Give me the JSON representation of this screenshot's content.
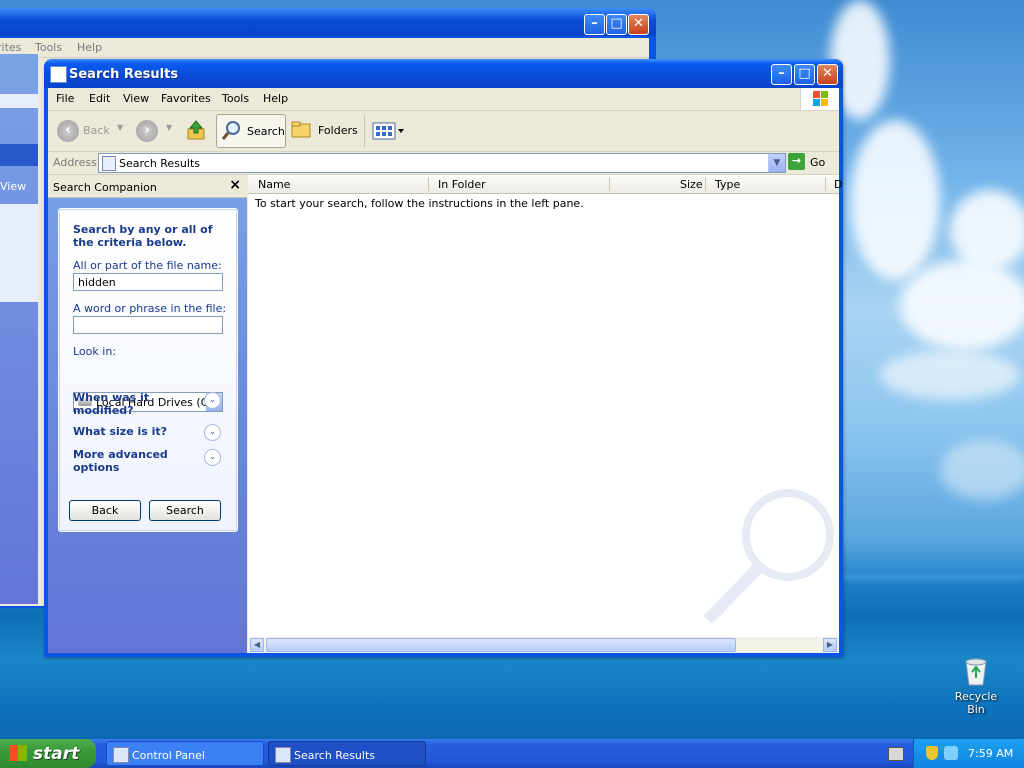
{
  "background_window": {
    "menu": [
      "rites",
      "Tools",
      "Help"
    ],
    "left_links": [
      "View"
    ]
  },
  "window": {
    "title": "Search Results",
    "menu": [
      "File",
      "Edit",
      "View",
      "Favorites",
      "Tools",
      "Help"
    ],
    "toolbar": {
      "back": "Back",
      "search": "Search",
      "folders": "Folders"
    },
    "address": {
      "label": "Address",
      "value": "Search Results",
      "go": "Go"
    }
  },
  "companion": {
    "title": "Search Companion",
    "heading": "Search by any or all of the criteria below.",
    "filename_label": "All or part of the file name:",
    "filename_value": "hidden",
    "phrase_label": "A word or phrase in the file:",
    "phrase_value": "",
    "lookin_label": "Look in:",
    "lookin_value": "Local Hard Drives (C:)",
    "options": [
      "When was it modified?",
      "What size is it?",
      "More advanced options"
    ],
    "back_button": "Back",
    "search_button": "Search"
  },
  "results": {
    "columns": [
      "Name",
      "In Folder",
      "Size",
      "Type",
      "D"
    ],
    "message": "To start your search, follow the instructions in the left pane."
  },
  "taskbar": {
    "start": "start",
    "tasks": [
      "Control Panel",
      "Search Results"
    ],
    "clock": "7:59 AM"
  },
  "desktop": {
    "recycle_bin": "Recycle Bin"
  }
}
